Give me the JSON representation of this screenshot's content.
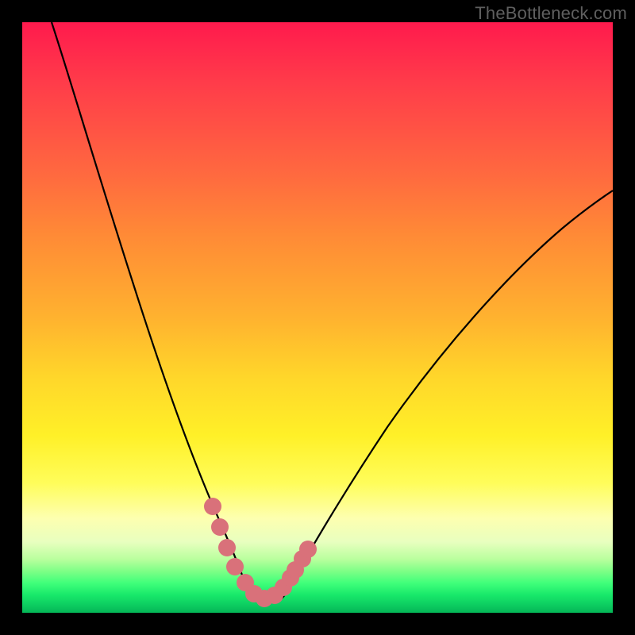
{
  "watermark": "TheBottleneck.com",
  "colors": {
    "background": "#000000",
    "curve_stroke": "#000000",
    "marker_fill": "#d9717a",
    "marker_stroke": "#d9717a"
  },
  "chart_data": {
    "type": "line",
    "title": "",
    "xlabel": "",
    "ylabel": "",
    "xlim": [
      0,
      100
    ],
    "ylim": [
      0,
      100
    ],
    "note": "V-shaped bottleneck curve on rainbow gradient; no axes or ticks are rendered. Values are pixel-approximate readings relative to the 744x744 plot area mapped to 0-100.",
    "series": [
      {
        "name": "left-branch",
        "x": [
          5,
          8,
          12,
          16,
          20,
          24,
          28,
          32,
          34,
          36,
          37.5
        ],
        "y": [
          100,
          90,
          78,
          66,
          54,
          42,
          30,
          18,
          12,
          7,
          4
        ]
      },
      {
        "name": "right-branch",
        "x": [
          44,
          48,
          54,
          62,
          72,
          82,
          92,
          100
        ],
        "y": [
          4,
          8,
          14,
          24,
          38,
          52,
          63,
          70
        ]
      },
      {
        "name": "valley-floor",
        "x": [
          37.5,
          39,
          41,
          43,
          44
        ],
        "y": [
          4,
          2.5,
          2,
          2.5,
          4
        ]
      }
    ],
    "markers": {
      "name": "highlight-dots",
      "points_xy": [
        [
          32.2,
          17.5
        ],
        [
          33.4,
          14.0
        ],
        [
          34.7,
          10.5
        ],
        [
          36.0,
          7.3
        ],
        [
          37.7,
          4.7
        ],
        [
          39.2,
          3.2
        ],
        [
          41.0,
          2.5
        ],
        [
          42.8,
          3.2
        ],
        [
          44.2,
          4.6
        ],
        [
          45.4,
          6.2
        ],
        [
          46.2,
          7.6
        ],
        [
          47.4,
          9.4
        ],
        [
          48.4,
          11.0
        ]
      ],
      "radius_px": 11
    }
  }
}
